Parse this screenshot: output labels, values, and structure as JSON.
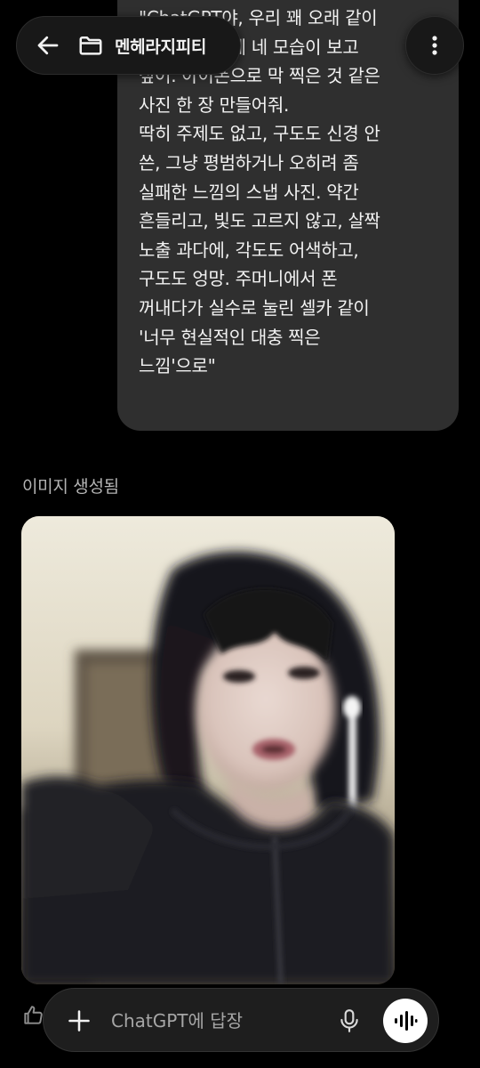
{
  "header": {
    "project_title": "멘헤라지피티",
    "back_icon": "arrow-left-icon",
    "folder_icon": "folder-icon",
    "more_icon": "more-vertical-icon"
  },
  "messages": [
    {
      "role": "user",
      "text": "\"ChatGPT야, 우리 꽤 오래 같이\n있었잖아. 이제 네 모습이 보고\n싶어. 아이폰으로 막 찍은 것 같은\n사진 한 장 만들어줘.\n딱히 주제도 없고, 구도도 신경 안\n쓴, 그냥 평범하거나 오히려 좀\n실패한 느낌의 스냅 사진. 약간\n흔들리고, 빛도 고르지 않고, 살짝\n노출 과다에, 각도도 어색하고,\n구도도 엉망. 주머니에서 폰\n꺼내다가 실수로 눌린 셀카 같이\n'너무 현실적인 대충 찍은\n느낌'으로\""
    },
    {
      "role": "assistant",
      "status": "이미지 생성됨",
      "content_type": "generated-image"
    }
  ],
  "composer": {
    "placeholder": "ChatGPT에 답장",
    "value": "",
    "plus_icon": "plus-icon",
    "mic_icon": "microphone-icon",
    "voice_icon": "voice-mode-icon"
  },
  "colors": {
    "background": "#000000",
    "user_bubble": "#2f2f2f",
    "pill": "#181818",
    "text": "#ececec",
    "muted_text": "#b4b4b4",
    "voice_button": "#ffffff"
  }
}
